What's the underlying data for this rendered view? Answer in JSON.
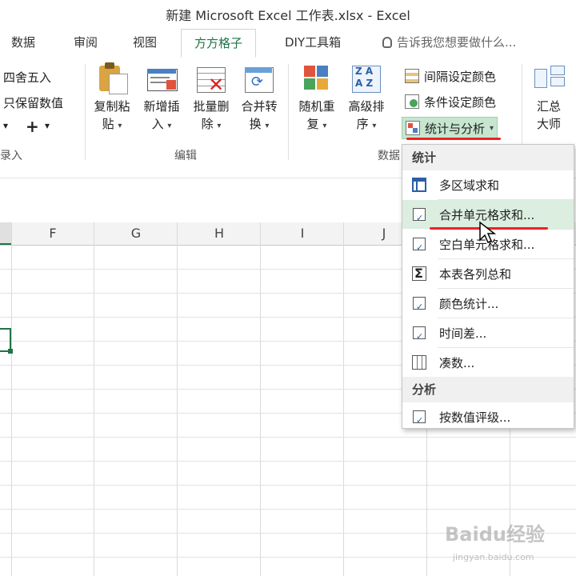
{
  "window": {
    "title": "新建 Microsoft Excel 工作表.xlsx - Excel"
  },
  "tabs": [
    {
      "label": "数据"
    },
    {
      "label": "审阅"
    },
    {
      "label": "视图"
    },
    {
      "label": "方方格子",
      "active": true
    },
    {
      "label": "DIY工具箱"
    }
  ],
  "tell_me": {
    "placeholder": "告诉我您想要做什么..."
  },
  "ribbon": {
    "left_partial": {
      "round_label": "四舍五入",
      "keep_label": "只保留数值",
      "plus": "+",
      "group_label": "录入"
    },
    "edit_group": {
      "buttons": [
        {
          "label_line1": "复制粘",
          "label_line2": "贴"
        },
        {
          "label_line1": "新增插",
          "label_line2": "入"
        },
        {
          "label_line1": "批量删",
          "label_line2": "除"
        },
        {
          "label_line1": "合并转",
          "label_line2": "换"
        }
      ],
      "group_label": "编辑"
    },
    "data_group": {
      "buttons": [
        {
          "label_line1": "随机重",
          "label_line2": "复"
        },
        {
          "label_line1": "高级排",
          "label_line2": "序"
        }
      ],
      "group_label": "数据"
    },
    "color_group": {
      "interval_color": "间隔设定颜色",
      "condition_color": "条件设定颜色",
      "stats_analysis": "统计与分析"
    },
    "summary": {
      "label_line1": "汇总",
      "label_line2": "大师"
    }
  },
  "grid": {
    "columns": [
      "F",
      "G",
      "H",
      "I",
      "J"
    ]
  },
  "menu": {
    "section_stats": "统计",
    "stats_items": [
      {
        "label": "多区域求和",
        "icon": "multi-range-icon"
      },
      {
        "label": "合并单元格求和...",
        "icon": "merge-cell-icon"
      },
      {
        "label": "空白单元格求和...",
        "icon": "blank-cell-icon"
      },
      {
        "label": "本表各列总和",
        "icon": "sigma-icon"
      },
      {
        "label": "颜色统计...",
        "icon": "color-stats-icon"
      },
      {
        "label": "时间差...",
        "icon": "time-diff-icon"
      },
      {
        "label": "凑数...",
        "icon": "grid-calc-icon"
      }
    ],
    "section_analysis": "分析",
    "analysis_items": [
      {
        "label": "按数值评级...",
        "icon": "rating-icon"
      }
    ]
  },
  "watermark": {
    "text": "Baidu经验",
    "url": "jingyan.baidu.com"
  },
  "colors": {
    "accent": "#217346",
    "annotation": "#e22222",
    "menu_hover": "#dbeee0"
  }
}
